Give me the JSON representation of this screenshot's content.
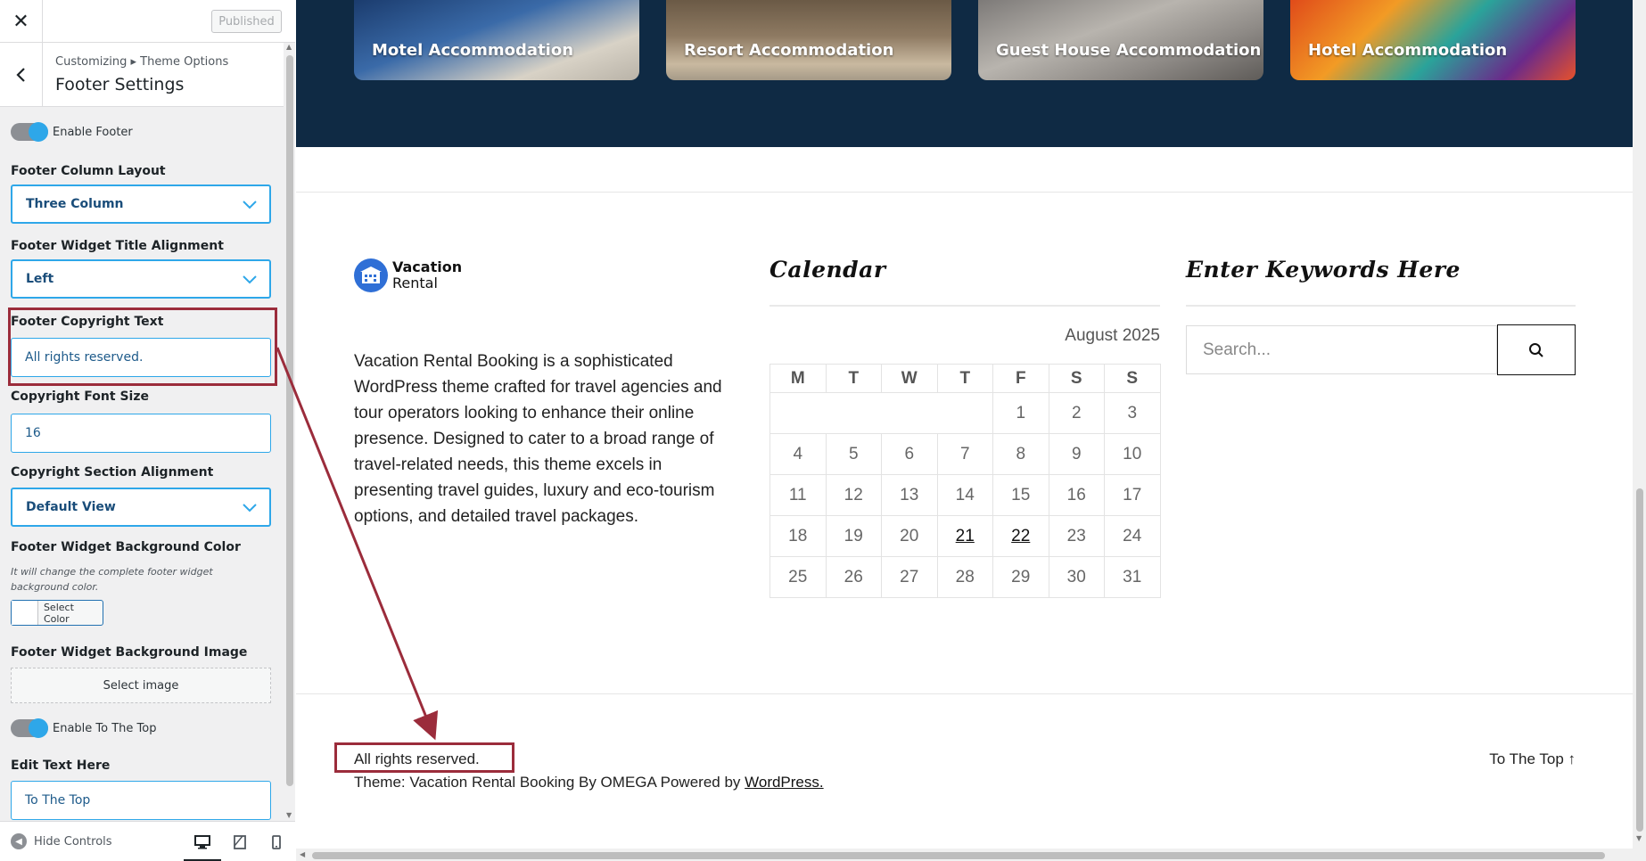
{
  "header": {
    "close_icon": "close-icon",
    "published_label": "Published"
  },
  "section": {
    "breadcrumb": "Customizing ▸ Theme Options",
    "title": "Footer Settings"
  },
  "controls": {
    "enable_footer_label": "Enable Footer",
    "enable_footer_on": true,
    "footer_column_layout_label": "Footer Column Layout",
    "footer_column_layout_value": "Three Column",
    "widget_title_alignment_label": "Footer Widget Title Alignment",
    "widget_title_alignment_value": "Left",
    "copyright_text_label": "Footer Copyright Text",
    "copyright_text_value": "All rights reserved.",
    "copyright_font_size_label": "Copyright Font Size",
    "copyright_font_size_value": "16",
    "copyright_alignment_label": "Copyright Section Alignment",
    "copyright_alignment_value": "Default View",
    "widget_bg_color_label": "Footer Widget Background Color",
    "widget_bg_color_desc": "It will change the complete footer widget background color.",
    "select_color_label": "Select Color",
    "widget_bg_image_label": "Footer Widget Background Image",
    "select_image_label": "Select image",
    "enable_to_top_label": "Enable To The Top",
    "enable_to_top_on": true,
    "edit_text_label": "Edit Text Here",
    "edit_text_value": "To The Top"
  },
  "sidebar_footer": {
    "hide_controls_label": "Hide Controls",
    "devices": [
      "desktop-icon",
      "tablet-icon",
      "mobile-icon"
    ],
    "active_device": "desktop"
  },
  "preview": {
    "cards": [
      {
        "caption": "Motel Accommodation"
      },
      {
        "caption": "Resort Accommodation"
      },
      {
        "caption": "Guest House Accommodation"
      },
      {
        "caption": "Hotel Accommodation"
      }
    ],
    "logo": {
      "line1": "Vacation",
      "line2": "Rental"
    },
    "about_text": "Vacation Rental Booking is a sophisticated WordPress theme crafted for travel agencies and tour operators looking to enhance their online presence. Designed to cater to a broad range of travel-related needs, this theme excels in presenting travel guides, luxury and eco-tourism options, and detailed travel packages.",
    "calendar_title": "Calendar",
    "calendar_caption": "August 2025",
    "calendar_days": [
      "M",
      "T",
      "W",
      "T",
      "F",
      "S",
      "S"
    ],
    "calendar_weeks": [
      [
        "",
        "",
        "",
        "",
        "1",
        "2",
        "3"
      ],
      [
        "4",
        "5",
        "6",
        "7",
        "8",
        "9",
        "10"
      ],
      [
        "11",
        "12",
        "13",
        "14",
        "15",
        "16",
        "17"
      ],
      [
        "18",
        "19",
        "20",
        "21",
        "22",
        "23",
        "24"
      ],
      [
        "25",
        "26",
        "27",
        "28",
        "29",
        "30",
        "31"
      ]
    ],
    "calendar_linked_days": [
      "21",
      "22"
    ],
    "search_title": "Enter Keywords Here",
    "search_placeholder": "Search...",
    "copyright": "All rights reserved.",
    "theme_credit_prefix": "Theme: Vacation Rental Booking By OMEGA Powered by ",
    "theme_credit_link": "WordPress.",
    "to_top": "To The Top ↑"
  },
  "colors": {
    "accent": "#2ea7e9",
    "highlight": "#9b2c3b",
    "hero_band": "#0f2a44"
  }
}
